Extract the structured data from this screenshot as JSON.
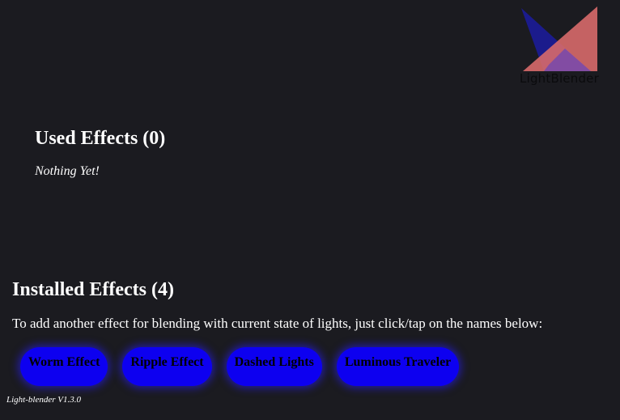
{
  "logo": {
    "text": "LightBlender",
    "colors": [
      "#1b1b8c",
      "#d86a6a",
      "#7a4aa8"
    ]
  },
  "used_effects": {
    "title": "Used Effects (0)",
    "empty_text": "Nothing Yet!"
  },
  "installed_effects": {
    "title": "Installed Effects (4)",
    "hint": "To add another effect for blending with current state of lights, just click/tap on the names below:",
    "items": [
      {
        "label": "Worm Effect"
      },
      {
        "label": "Ripple Effect"
      },
      {
        "label": "Dashed Lights"
      },
      {
        "label": "Luminous Traveler"
      }
    ],
    "button_color": "#0d00f0"
  },
  "footer": {
    "version": "Light-blender V1.3.0"
  }
}
